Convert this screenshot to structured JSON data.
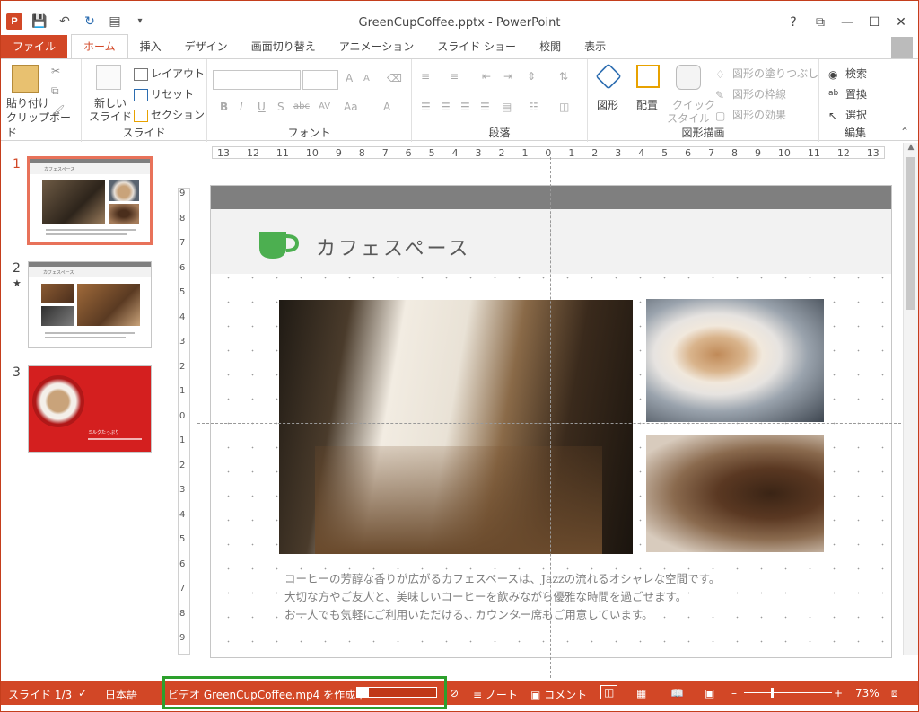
{
  "app": {
    "title": "GreenCupCoffee.pptx - PowerPoint",
    "app_icon": "P",
    "window_controls": [
      "?",
      "⧉",
      "—",
      "☐",
      "✕"
    ]
  },
  "tabs": {
    "file": "ファイル",
    "items": [
      "ホーム",
      "挿入",
      "デザイン",
      "画面切り替え",
      "アニメーション",
      "スライド ショー",
      "校閲",
      "表示"
    ]
  },
  "ribbon": {
    "clipboard": {
      "paste": "貼り付け",
      "label": "クリップボード"
    },
    "slides": {
      "new_slide": "新しい",
      "new_slide2": "スライド",
      "layout": "レイアウト",
      "reset": "リセット",
      "section": "セクション",
      "label": "スライド"
    },
    "font": {
      "label": "フォント",
      "bold": "B",
      "italic": "I",
      "underline": "U",
      "shadow": "S",
      "strike": "abc",
      "spacing": "AV",
      "case": "Aa",
      "grow": "A",
      "shrink": "A",
      "color": "A"
    },
    "paragraph": {
      "label": "段落"
    },
    "drawing": {
      "shapes": "図形",
      "arrange": "配置",
      "quick_style": "クイック",
      "quick_style2": "スタイル",
      "fill": "図形の塗りつぶし",
      "outline": "図形の枠線",
      "effects": "図形の効果",
      "label": "図形描画"
    },
    "editing": {
      "find": "検索",
      "replace": "置換",
      "select": "選択",
      "label": "編集"
    }
  },
  "slides_pane": {
    "slides": [
      {
        "num": "1",
        "thumb_title": "カフェスペース"
      },
      {
        "num": "2",
        "thumb_title": "カフェスペース",
        "star": "★"
      },
      {
        "num": "3",
        "thumb_title": "ミルクたっぷり"
      }
    ]
  },
  "ruler": {
    "h_ticks": [
      "13",
      "12",
      "11",
      "10",
      "9",
      "8",
      "7",
      "6",
      "5",
      "4",
      "3",
      "2",
      "1",
      "0",
      "1",
      "2",
      "3",
      "4",
      "5",
      "6",
      "7",
      "8",
      "9",
      "10",
      "11",
      "12",
      "13"
    ],
    "v_ticks": [
      "9",
      "8",
      "7",
      "6",
      "5",
      "4",
      "3",
      "2",
      "1",
      "0",
      "1",
      "2",
      "3",
      "4",
      "5",
      "6",
      "7",
      "8",
      "9"
    ]
  },
  "slide": {
    "title": "カフェスペース",
    "body": [
      "コーヒーの芳醇な香りが広がるカフェスペースは、Jazzの流れるオシャレな空間です。",
      "大切な方やご友人と、美味しいコーヒーを飲みながら優雅な時間を過ごせます。",
      "お一人でも気軽にご利用いただける、カウンター席もご用意しています。"
    ],
    "accent": "#4caf50"
  },
  "status": {
    "slide": "スライド 1/3",
    "language": "日本語",
    "video": "ビデオ GreenCupCoffee.mp4 を作成中",
    "progress": 0.15,
    "notes": "ノート",
    "comments": "コメント",
    "zoom": "73%"
  },
  "colors": {
    "brand": "#d24726",
    "highlight": "#2ca02c"
  }
}
